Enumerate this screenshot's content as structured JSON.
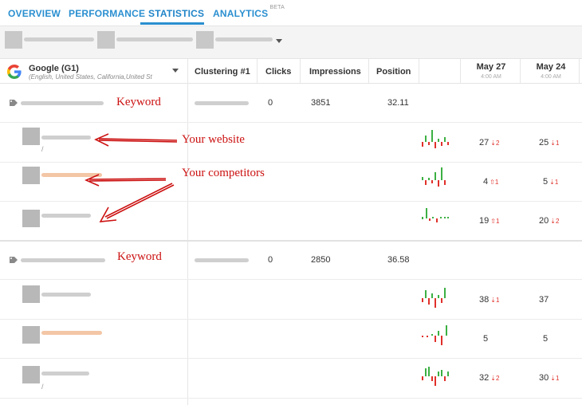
{
  "tabs": [
    {
      "label": "OVERVIEW"
    },
    {
      "label": "PERFORMANCE"
    },
    {
      "label": "STATISTICS"
    },
    {
      "label": "ANALYTICS",
      "sup": "BETA"
    }
  ],
  "engine": {
    "name": "Google (G1)",
    "subtitle": "(English, United States, California,United St"
  },
  "columns": {
    "clustering": "Clustering #1",
    "clicks": "Clicks",
    "impressions": "Impressions",
    "position": "Position"
  },
  "dates": [
    {
      "date": "May 27",
      "time": "4:00 AM"
    },
    {
      "date": "May 24",
      "time": "4:00 AM"
    }
  ],
  "keyword_rows": [
    {
      "clicks": "0",
      "impressions": "3851",
      "position": "32.11"
    },
    {
      "clicks": "0",
      "impressions": "2850",
      "position": "36.58"
    }
  ],
  "site_rows": [
    {
      "slash": "/",
      "d1": "27",
      "d1_delta": "⇣2",
      "d2": "25",
      "d2_delta": "⇣1"
    },
    {
      "slash": "",
      "d1": "4",
      "d1_delta": "⇧1",
      "d2": "5",
      "d2_delta": "⇣1"
    },
    {
      "slash": "",
      "d1": "19",
      "d1_delta": "⇧1",
      "d2": "20",
      "d2_delta": "⇣2"
    },
    {
      "slash": "",
      "d1": "38",
      "d1_delta": "⇣1",
      "d2": "37",
      "d2_delta": ""
    },
    {
      "slash": "",
      "d1": "5",
      "d1_delta": "",
      "d2": "5",
      "d2_delta": ""
    },
    {
      "slash": "/",
      "d1": "32",
      "d1_delta": "⇣2",
      "d2": "30",
      "d2_delta": "⇣1"
    }
  ],
  "annotations": {
    "keyword_1": "Keyword",
    "keyword_2": "Keyword",
    "your_website": "Your website",
    "your_competitors": "Your competitors"
  },
  "colors": {
    "accent": "#2a8fd0",
    "up": "#3cb043",
    "down": "#e0302a",
    "annotation": "#cc1111"
  }
}
